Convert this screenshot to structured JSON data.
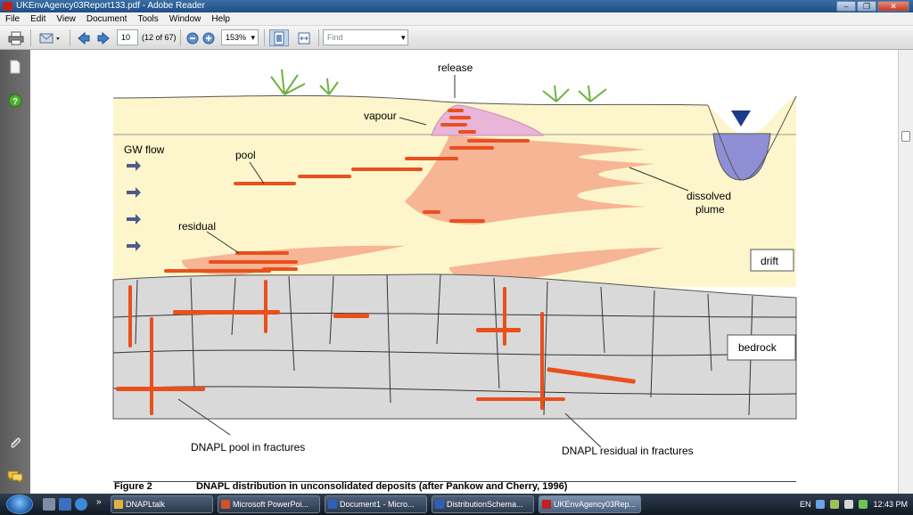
{
  "window": {
    "title": "UKEnvAgency03Report133.pdf - Adobe Reader",
    "controls": [
      "–",
      "❐",
      "✕"
    ]
  },
  "menu": [
    "File",
    "Edit",
    "View",
    "Document",
    "Tools",
    "Window",
    "Help"
  ],
  "toolbar": {
    "page_number": "10",
    "page_count": "(12 of 67)",
    "zoom": "153%",
    "find_placeholder": "Find"
  },
  "figure": {
    "labels": {
      "release": "release",
      "vapour": "vapour",
      "gw_flow": "GW flow",
      "pool": "pool",
      "dissolved_line1": "dissolved",
      "dissolved_line2": "plume",
      "residual": "residual",
      "drift": "drift",
      "bedrock": "bedrock",
      "dnapl_pool": "DNAPL pool in fractures",
      "dnapl_residual": "DNAPL residual in fractures"
    },
    "colors": {
      "drift": "#fdf6cc",
      "bedrock": "#d9d9d9",
      "plume": "#f4a98a",
      "dnapl": "#e8501e",
      "vapour": "#e9b5d8",
      "water": "#8f8fd6"
    }
  },
  "caption": {
    "number": "Figure 2",
    "text": "DNAPL distribution in unconsolidated deposits (after Pankow and Cherry, 1996)"
  },
  "taskbar": {
    "tasks": [
      "DNAPLtalk",
      "Microsoft PowerPoi...",
      "Document1 - Micro...",
      "DistributionSchema...",
      "UKEnvAgency03Rep..."
    ],
    "lang": "EN",
    "time": "12:43 PM"
  }
}
